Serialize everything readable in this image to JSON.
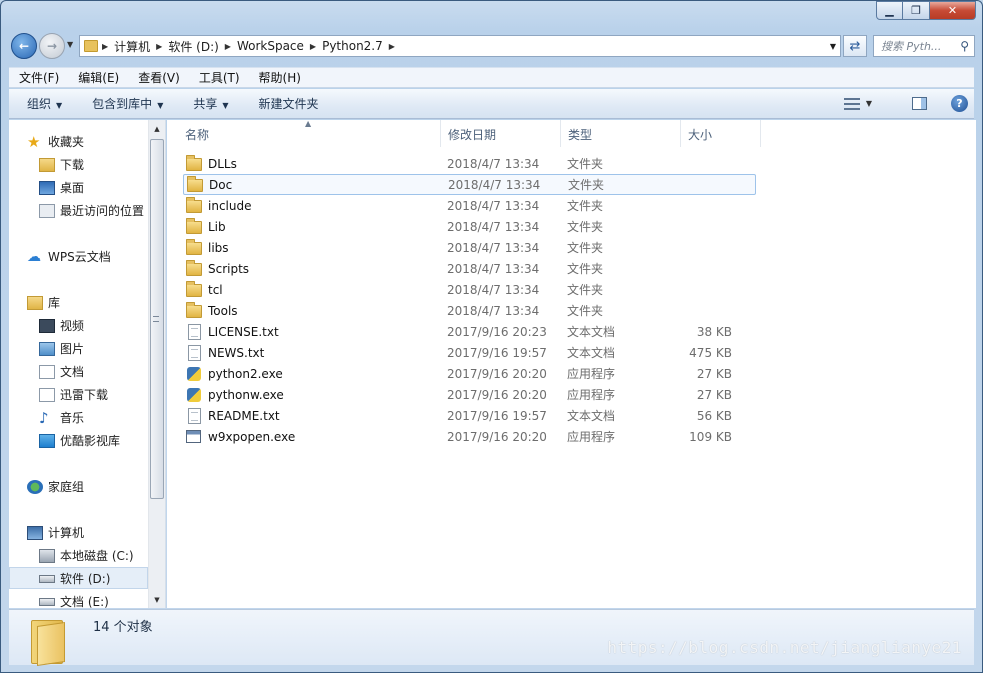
{
  "address": {
    "crumbs": [
      "计算机",
      "软件 (D:)",
      "WorkSpace",
      "Python2.7"
    ]
  },
  "search": {
    "placeholder": "搜索 Pyth..."
  },
  "menu": [
    "文件(F)",
    "编辑(E)",
    "查看(V)",
    "工具(T)",
    "帮助(H)"
  ],
  "toolbar": {
    "organize": "组织",
    "include_in_library": "包含到库中",
    "share": "共享",
    "new_folder": "新建文件夹"
  },
  "sidebar": {
    "favorites": "收藏夹",
    "downloads": "下载",
    "desktop": "桌面",
    "recent": "最近访问的位置",
    "wps": "WPS云文档",
    "libraries": "库",
    "videos": "视频",
    "pictures": "图片",
    "documents": "文档",
    "thunder": "迅雷下载",
    "music": "音乐",
    "youku": "优酷影视库",
    "homegroup": "家庭组",
    "computer": "计算机",
    "drive_c": "本地磁盘 (C:)",
    "drive_d": "软件 (D:)",
    "drive_e": "文档 (E:)"
  },
  "columns": {
    "name": "名称",
    "date": "修改日期",
    "type": "类型",
    "size": "大小"
  },
  "files": [
    {
      "name": "DLLs",
      "date": "2018/4/7 13:34",
      "type": "文件夹",
      "size": "",
      "icon": "folder"
    },
    {
      "name": "Doc",
      "date": "2018/4/7 13:34",
      "type": "文件夹",
      "size": "",
      "icon": "folder"
    },
    {
      "name": "include",
      "date": "2018/4/7 13:34",
      "type": "文件夹",
      "size": "",
      "icon": "folder"
    },
    {
      "name": "Lib",
      "date": "2018/4/7 13:34",
      "type": "文件夹",
      "size": "",
      "icon": "folder"
    },
    {
      "name": "libs",
      "date": "2018/4/7 13:34",
      "type": "文件夹",
      "size": "",
      "icon": "folder"
    },
    {
      "name": "Scripts",
      "date": "2018/4/7 13:34",
      "type": "文件夹",
      "size": "",
      "icon": "folder"
    },
    {
      "name": "tcl",
      "date": "2018/4/7 13:34",
      "type": "文件夹",
      "size": "",
      "icon": "folder"
    },
    {
      "name": "Tools",
      "date": "2018/4/7 13:34",
      "type": "文件夹",
      "size": "",
      "icon": "folder"
    },
    {
      "name": "LICENSE.txt",
      "date": "2017/9/16 20:23",
      "type": "文本文档",
      "size": "38 KB",
      "icon": "txt"
    },
    {
      "name": "NEWS.txt",
      "date": "2017/9/16 19:57",
      "type": "文本文档",
      "size": "475 KB",
      "icon": "txt"
    },
    {
      "name": "python2.exe",
      "date": "2017/9/16 20:20",
      "type": "应用程序",
      "size": "27 KB",
      "icon": "py"
    },
    {
      "name": "pythonw.exe",
      "date": "2017/9/16 20:20",
      "type": "应用程序",
      "size": "27 KB",
      "icon": "py"
    },
    {
      "name": "README.txt",
      "date": "2017/9/16 19:57",
      "type": "文本文档",
      "size": "56 KB",
      "icon": "txt"
    },
    {
      "name": "w9xpopen.exe",
      "date": "2017/9/16 20:20",
      "type": "应用程序",
      "size": "109 KB",
      "icon": "exe"
    }
  ],
  "selected_file": "Doc",
  "status": {
    "count": "14 个对象"
  },
  "watermark": "https://blog.csdn.net/jianglianye21"
}
